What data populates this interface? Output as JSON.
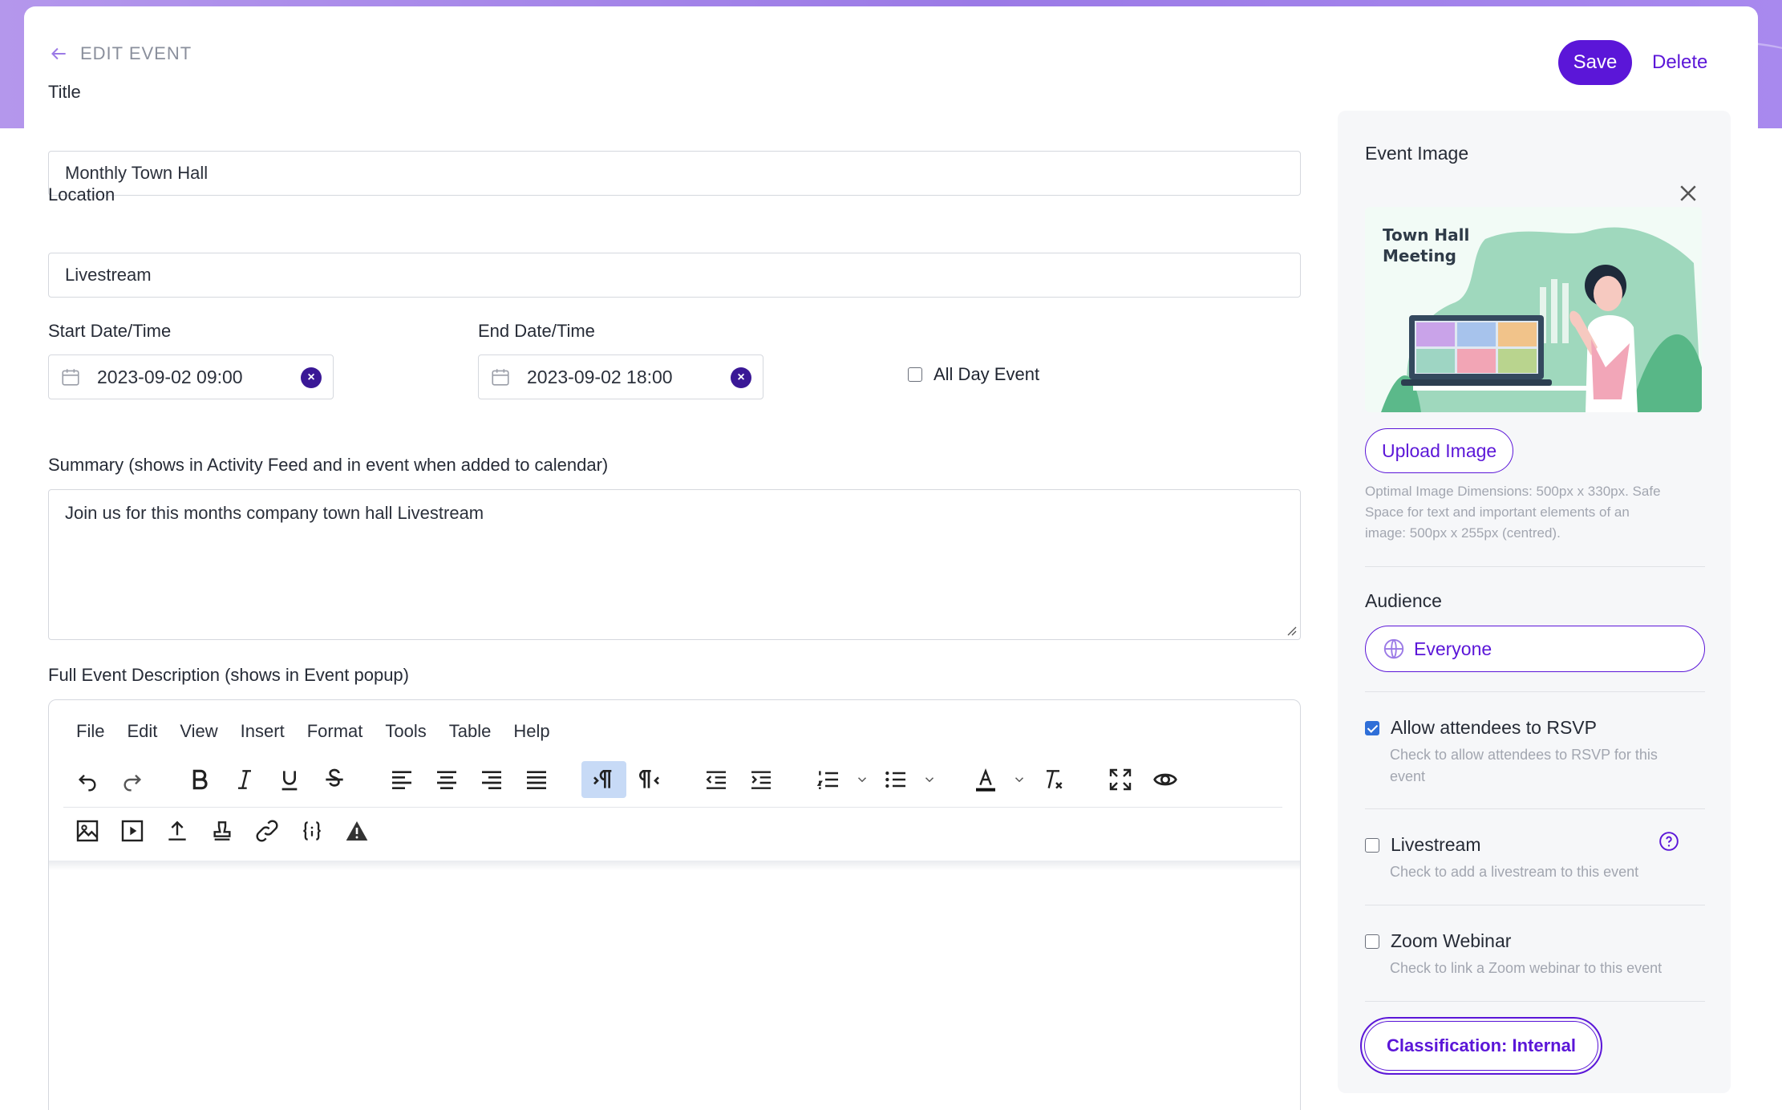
{
  "header": {
    "back_label": "EDIT EVENT",
    "save_label": "Save",
    "delete_label": "Delete"
  },
  "form": {
    "title_label": "Title",
    "title_value": "Monthly Town Hall",
    "location_label": "Location",
    "location_value": "Livestream",
    "start_label": "Start Date/Time",
    "start_value": "2023-09-02 09:00",
    "end_label": "End Date/Time",
    "end_value": "2023-09-02 18:00",
    "all_day_label": "All Day Event",
    "all_day_checked": false,
    "summary_label": "Summary (shows in Activity Feed and in event when added to calendar)",
    "summary_value": "Join us for this months company town hall Livestream",
    "description_label": "Full Event Description (shows in Event popup)"
  },
  "editor": {
    "menu": [
      "File",
      "Edit",
      "View",
      "Insert",
      "Format",
      "Tools",
      "Table",
      "Help"
    ],
    "toolbar_row1": [
      "undo-icon",
      "redo-icon",
      "bold-icon",
      "italic-icon",
      "underline-icon",
      "strikethrough-icon",
      "align-left-icon",
      "align-center-icon",
      "align-right-icon",
      "align-justify-icon",
      "ltr-icon",
      "rtl-icon",
      "outdent-icon",
      "indent-icon",
      "numbered-list-icon",
      "bullet-list-icon",
      "text-color-icon",
      "clear-format-icon",
      "fullscreen-icon",
      "preview-icon"
    ],
    "toolbar_row2": [
      "image-icon",
      "media-icon",
      "upload-icon",
      "stamp-icon",
      "link-icon",
      "code-braces-icon",
      "warning-icon"
    ]
  },
  "side": {
    "image_heading": "Event Image",
    "image_text_line1": "Town Hall",
    "image_text_line2": "Meeting",
    "upload_label": "Upload Image",
    "hint_line1": "Optimal Image Dimensions: 500px x 330px. Safe",
    "hint_line2": "Space for text and important elements of an",
    "hint_line3": "image: 500px x 255px (centred).",
    "audience_heading": "Audience",
    "audience_value": "Everyone",
    "rsvp_label": "Allow attendees to RSVP",
    "rsvp_checked": true,
    "rsvp_desc_line1": "Check to allow attendees to RSVP for this",
    "rsvp_desc_line2": "event",
    "livestream_label": "Livestream",
    "livestream_checked": false,
    "livestream_desc": "Check to add a livestream to this event",
    "zoom_label": "Zoom Webinar",
    "zoom_checked": false,
    "zoom_desc": "Check to link a Zoom webinar to this event",
    "classification_label": "Classification: Internal"
  },
  "colors": {
    "accent": "#5b16d8",
    "band": "#a889ee",
    "active_tool": "#c7daf6",
    "checkbox_checked": "#2f6fd8"
  }
}
